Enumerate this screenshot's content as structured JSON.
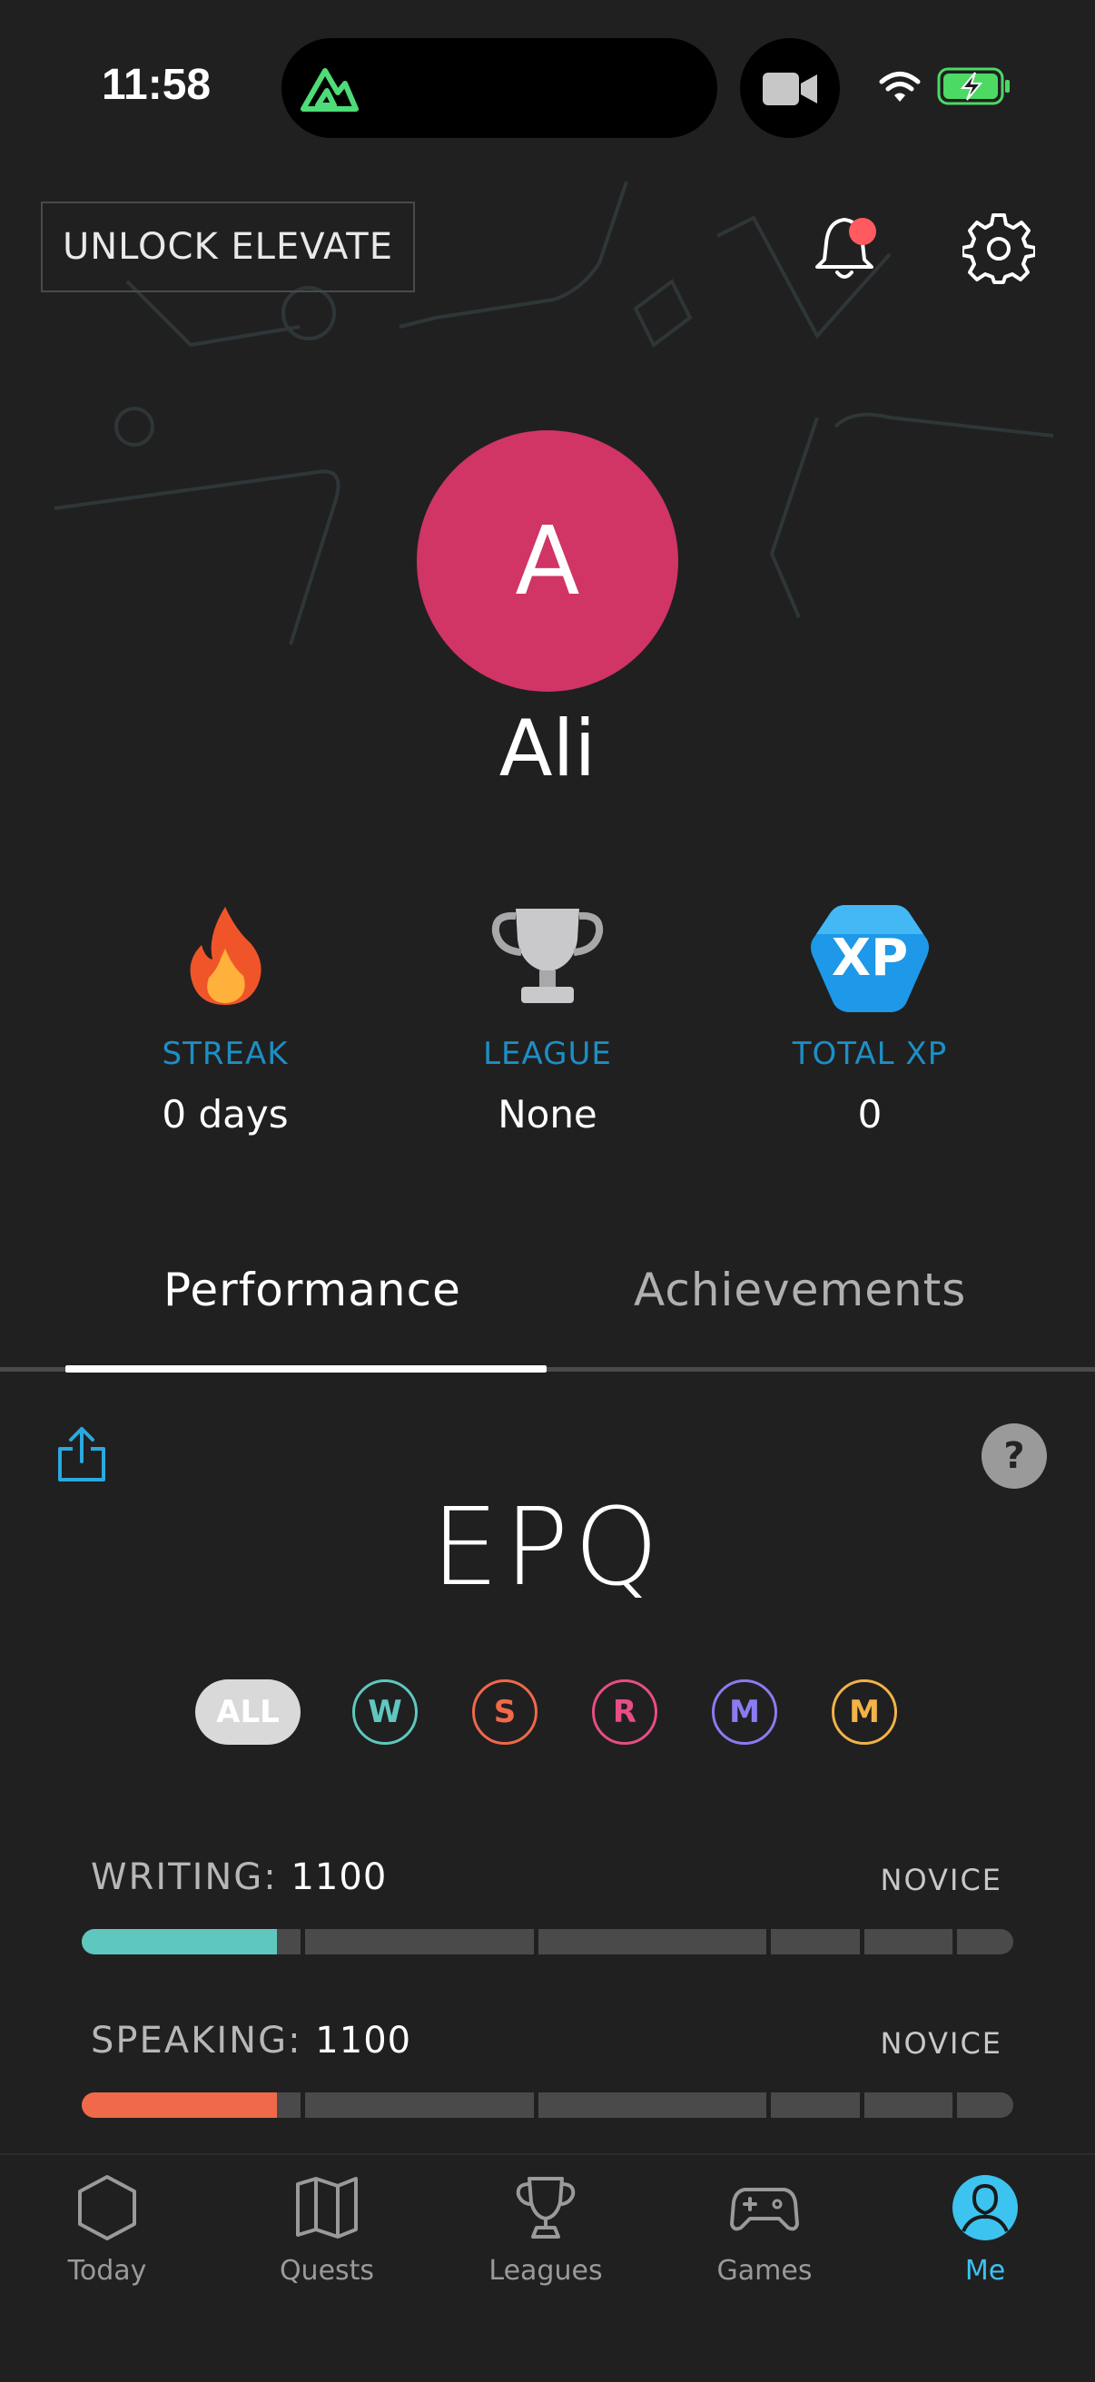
{
  "status_bar": {
    "time": "11:58"
  },
  "header": {
    "unlock_label": "UNLOCK ELEVATE"
  },
  "profile": {
    "avatar_initial": "A",
    "name": "Ali",
    "avatar_color": "#d03565"
  },
  "stats": [
    {
      "label": "STREAK",
      "value": "0 days",
      "icon": "flame-icon"
    },
    {
      "label": "LEAGUE",
      "value": "None",
      "icon": "trophy-icon"
    },
    {
      "label": "TOTAL XP",
      "value": "0",
      "icon": "xp-badge-icon",
      "icon_text": "XP"
    }
  ],
  "tabs": [
    {
      "label": "Performance",
      "active": true
    },
    {
      "label": "Achievements",
      "active": false
    }
  ],
  "epq": {
    "title": "EPQ",
    "help_label": "?",
    "filters": [
      {
        "label": "ALL",
        "selected": true
      },
      {
        "label": "W",
        "color": "#5ec8bf"
      },
      {
        "label": "S",
        "color": "#f0694a"
      },
      {
        "label": "R",
        "color": "#e84d86"
      },
      {
        "label": "M",
        "color": "#8a7cf0"
      },
      {
        "label": "M",
        "color": "#f2b347"
      }
    ],
    "skills": [
      {
        "name": "WRITING:",
        "score": "1100",
        "level": "NOVICE",
        "color": "#5ec8bf",
        "progress": 0.21
      },
      {
        "name": "SPEAKING:",
        "score": "1100",
        "level": "NOVICE",
        "color": "#f0694a",
        "progress": 0.21
      }
    ]
  },
  "nav": [
    {
      "label": "Today",
      "icon": "hexagon-icon",
      "active": false
    },
    {
      "label": "Quests",
      "icon": "map-icon",
      "active": false
    },
    {
      "label": "Leagues",
      "icon": "trophy-icon",
      "active": false
    },
    {
      "label": "Games",
      "icon": "gamepad-icon",
      "active": false
    },
    {
      "label": "Me",
      "icon": "profile-icon",
      "active": true
    }
  ],
  "colors": {
    "accent": "#1d8fc4",
    "active_nav": "#3cc3ef",
    "background": "#202021"
  }
}
